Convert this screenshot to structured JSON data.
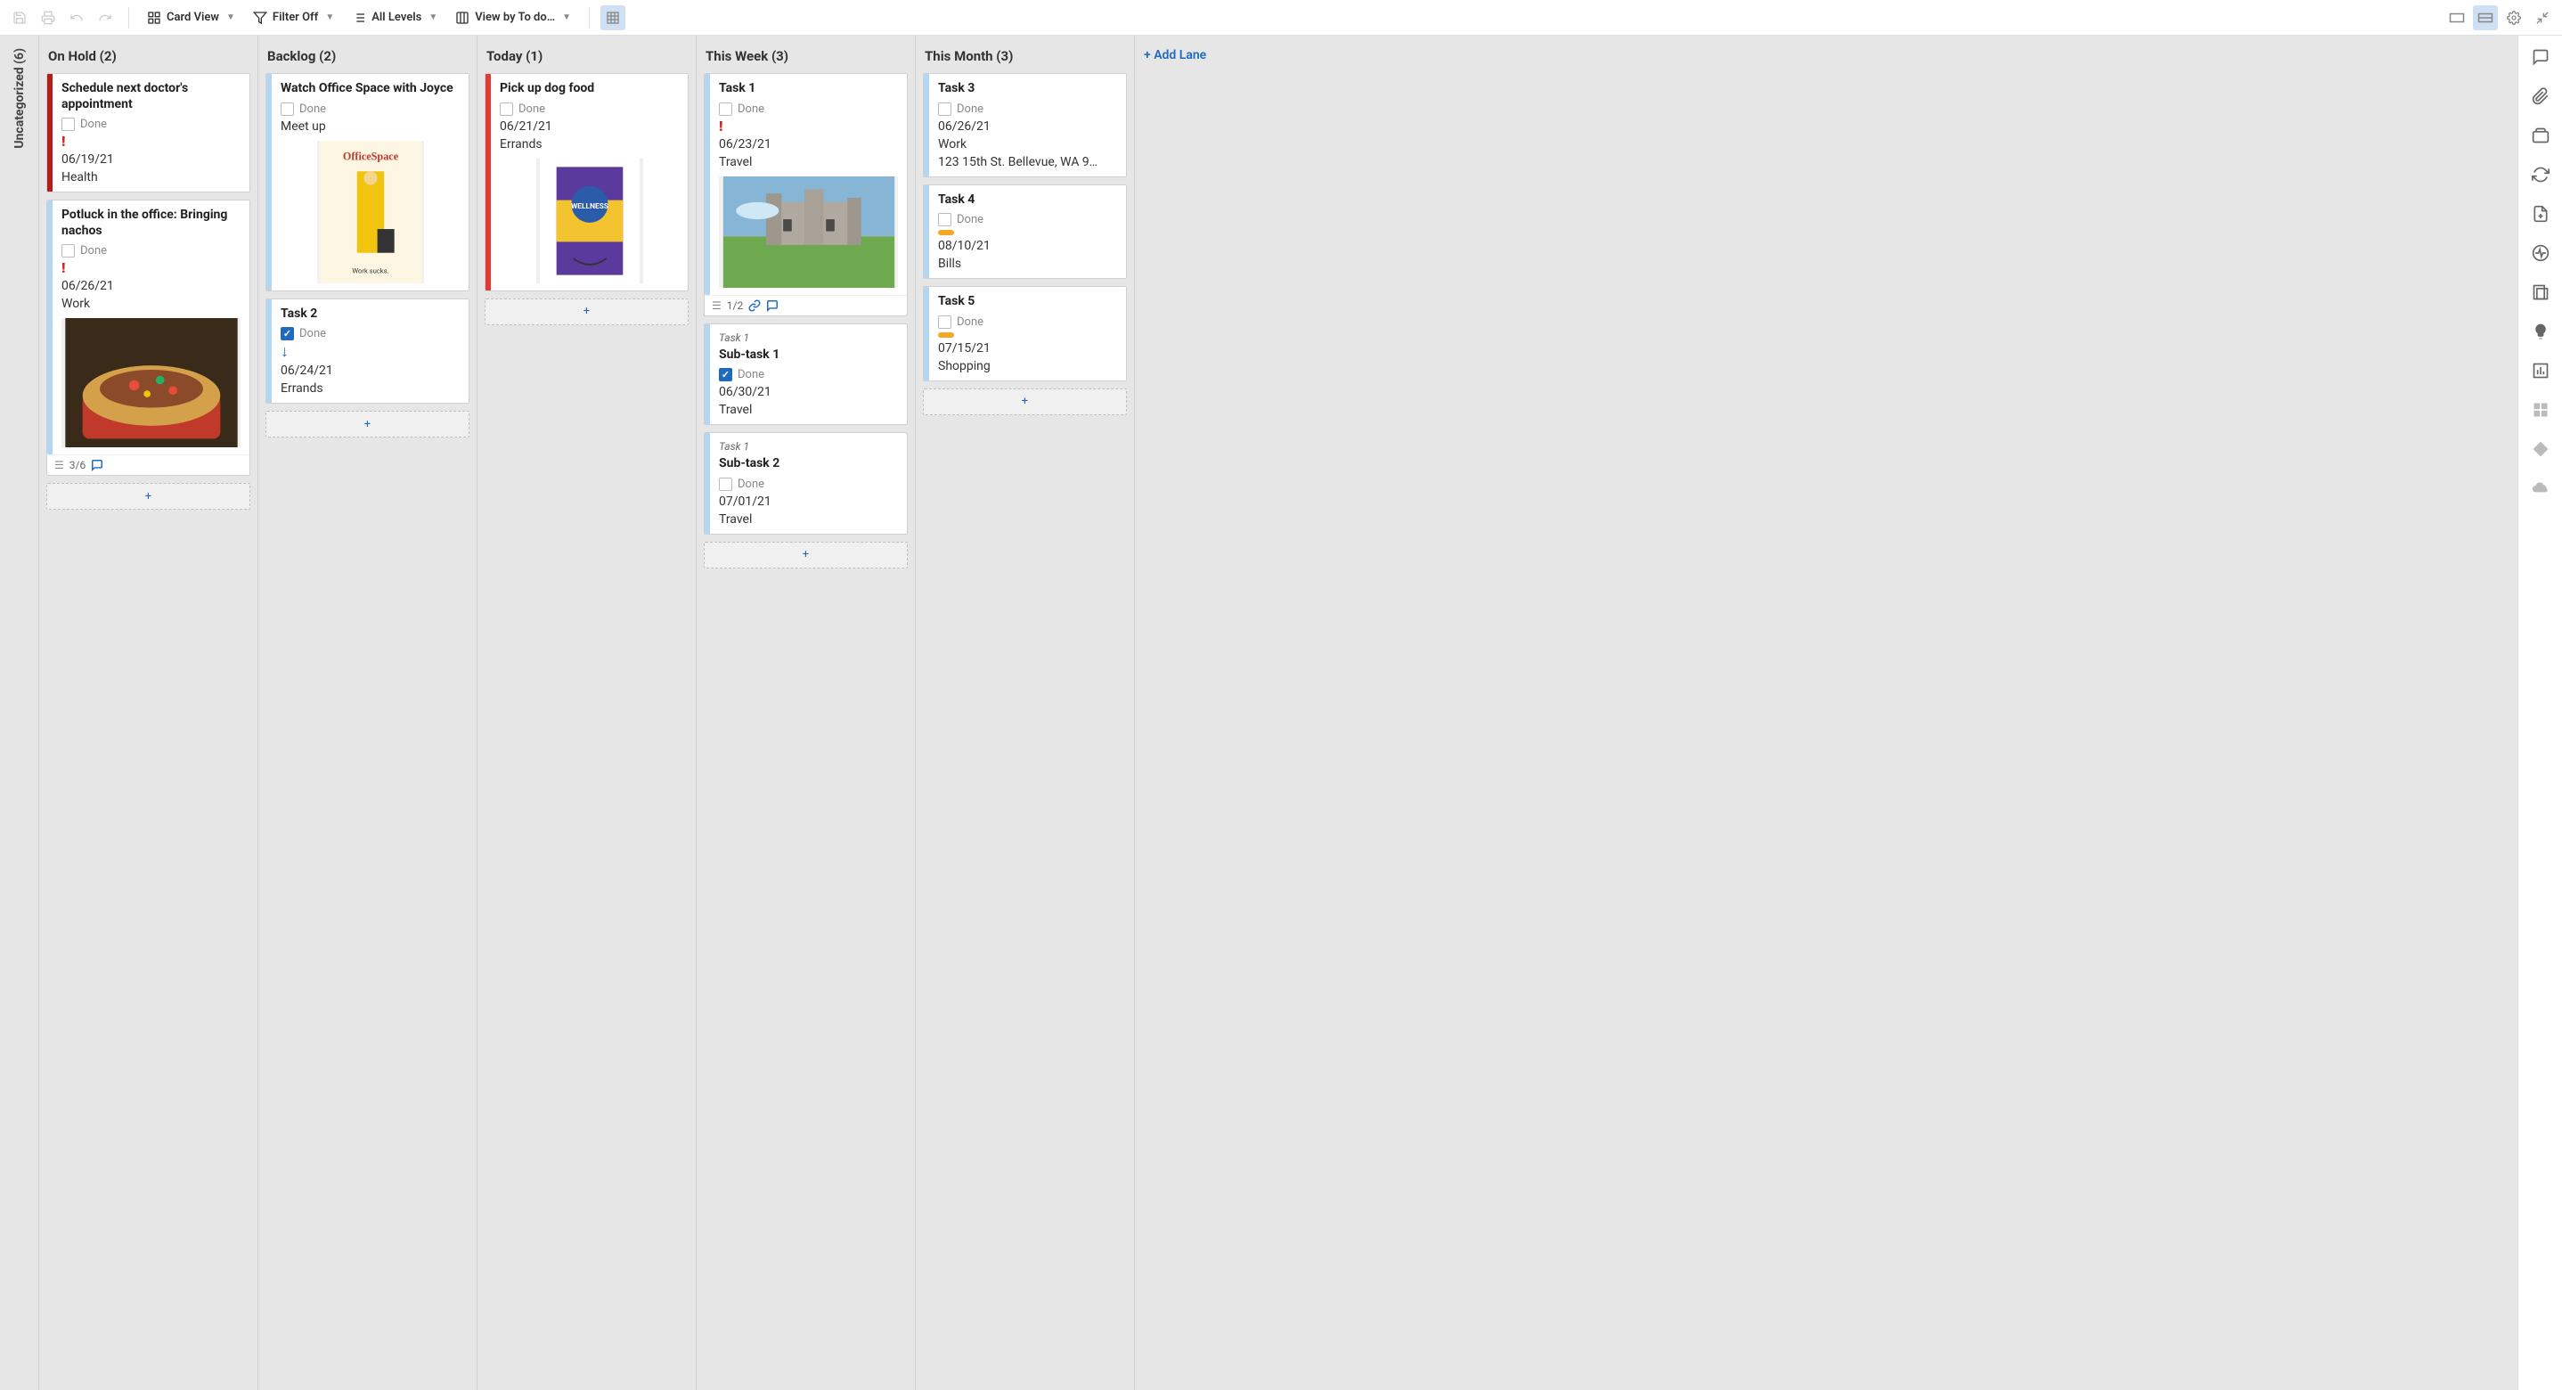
{
  "toolbar": {
    "view_label": "Card View",
    "filter_label": "Filter Off",
    "levels_label": "All Levels",
    "viewby_label": "View by To do…"
  },
  "rail": {
    "uncategorized_label": "Uncategorized (6)"
  },
  "add_lane_label": "Add Lane",
  "done_label": "Done",
  "lanes": [
    {
      "id": "onhold",
      "title": "On Hold (2)",
      "cards": [
        {
          "title": "Schedule next doctor's appointment",
          "done": false,
          "priority": "high",
          "date": "06/19/21",
          "category": "Health",
          "edge": "red"
        },
        {
          "title": "Potluck in the office: Bringing nachos",
          "done": false,
          "priority": "high",
          "date": "06/26/21",
          "category": "Work",
          "edge": "blue",
          "image": "nachos",
          "footer": {
            "subtasks": "3/6",
            "comments": true
          }
        }
      ]
    },
    {
      "id": "backlog",
      "title": "Backlog (2)",
      "cards": [
        {
          "title": "Watch Office Space with Joyce",
          "done": false,
          "date": "",
          "category": "Meet up",
          "edge": "blue",
          "image": "officespace"
        },
        {
          "title": "Task 2",
          "done": true,
          "priority": "low",
          "date": "06/24/21",
          "category": "Errands",
          "edge": "blue"
        }
      ]
    },
    {
      "id": "today",
      "title": "Today (1)",
      "cards": [
        {
          "title": "Pick up dog food",
          "done": false,
          "date": "06/21/21",
          "category": "Errands",
          "edge": "bright",
          "image": "dogfood"
        }
      ]
    },
    {
      "id": "thisweek",
      "title": "This Week (3)",
      "cards": [
        {
          "title": "Task 1",
          "done": false,
          "priority": "high",
          "date": "06/23/21",
          "category": "Travel",
          "edge": "blue",
          "image": "castle",
          "footer": {
            "subtasks": "1/2",
            "link": true,
            "comments": true
          }
        },
        {
          "parent": "Task 1",
          "title": "Sub-task 1",
          "done": true,
          "date": "06/30/21",
          "category": "Travel",
          "edge": "blue"
        },
        {
          "parent": "Task 1",
          "title": "Sub-task 2",
          "done": false,
          "date": "07/01/21",
          "category": "Travel",
          "edge": "blue"
        }
      ]
    },
    {
      "id": "thismonth",
      "title": "This Month (3)",
      "cards": [
        {
          "title": "Task 3",
          "done": false,
          "date": "06/26/21",
          "category": "Work",
          "location": "123 15th St. Bellevue, WA 9…",
          "edge": "blue"
        },
        {
          "title": "Task 4",
          "done": false,
          "priority": "pill",
          "date": "08/10/21",
          "category": "Bills",
          "edge": "blue"
        },
        {
          "title": "Task 5",
          "done": false,
          "priority": "pill",
          "date": "07/15/21",
          "category": "Shopping",
          "edge": "blue"
        }
      ]
    }
  ]
}
